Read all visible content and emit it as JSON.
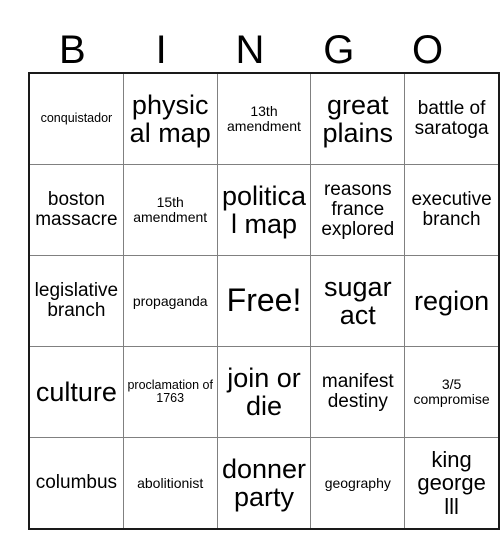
{
  "card": {
    "title_letters": [
      "B",
      "I",
      "N",
      "G",
      "O"
    ],
    "free_space_label": "Free!",
    "grid_line_color": "#808080",
    "frame_color": "#1a1a1a",
    "background_color": "#ffffff",
    "text_color": "#000000",
    "columns": 5,
    "rows": 5,
    "cells": [
      [
        {
          "text": "conquistador",
          "size": "xs"
        },
        {
          "text": "physical map",
          "size": "xl"
        },
        {
          "text": "13th amendment",
          "size": "sm"
        },
        {
          "text": "great plains",
          "size": "xl"
        },
        {
          "text": "battle of saratoga",
          "size": "md"
        }
      ],
      [
        {
          "text": "boston massacre",
          "size": "md"
        },
        {
          "text": "15th amendment",
          "size": "sm"
        },
        {
          "text": "political map",
          "size": "xl"
        },
        {
          "text": "reasons france explored",
          "size": "md"
        },
        {
          "text": "executive branch",
          "size": "md"
        }
      ],
      [
        {
          "text": "legislative branch",
          "size": "md"
        },
        {
          "text": "propaganda",
          "size": "sm"
        },
        {
          "text": "Free!",
          "size": "xxl"
        },
        {
          "text": "sugar act",
          "size": "xl"
        },
        {
          "text": "region",
          "size": "xl"
        }
      ],
      [
        {
          "text": "culture",
          "size": "xl"
        },
        {
          "text": "proclamation of 1763",
          "size": "xs"
        },
        {
          "text": "join or die",
          "size": "xl"
        },
        {
          "text": "manifest destiny",
          "size": "md"
        },
        {
          "text": "3/5 compromise",
          "size": "sm"
        }
      ],
      [
        {
          "text": "columbus",
          "size": "md"
        },
        {
          "text": "abolitionist",
          "size": "sm"
        },
        {
          "text": "donner party",
          "size": "xl"
        },
        {
          "text": "geography",
          "size": "sm"
        },
        {
          "text": "king george lll",
          "size": "lg"
        }
      ]
    ]
  }
}
